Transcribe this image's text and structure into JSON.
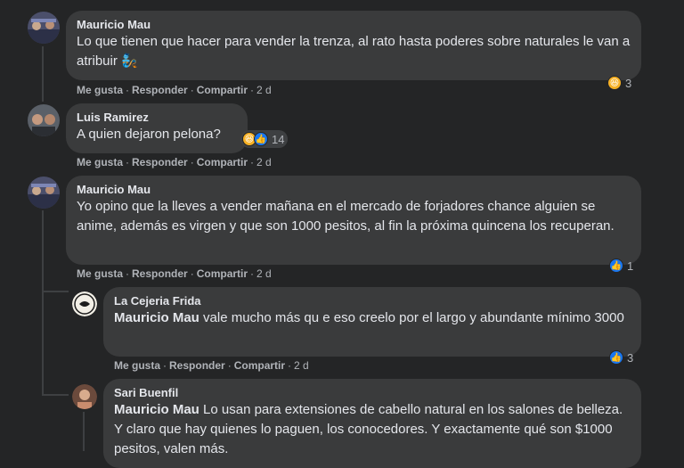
{
  "actions": {
    "like": "Me gusta",
    "reply": "Responder",
    "share": "Compartir",
    "sep": "·"
  },
  "comments": [
    {
      "author": "Mauricio Mau",
      "text": "Lo que tienen que hacer para vender la trenza, al rato hasta poderes sobre naturales le van a atribuir 🧞",
      "time": "2 d",
      "reactions": {
        "icons": [
          "haha"
        ],
        "count": "3"
      }
    },
    {
      "author": "Luis Ramirez",
      "text": "A quien dejaron pelona?",
      "time": "2 d",
      "reactions": {
        "icons": [
          "haha",
          "like"
        ],
        "count": "14"
      }
    },
    {
      "author": "Mauricio Mau",
      "text": "Yo opino que la lleves a vender mañana en el mercado de forjadores chance alguien se anime, además es virgen y que son 1000 pesitos, al fin la próxima quincena los recuperan.",
      "time": "2 d",
      "reactions": {
        "icons": [
          "like"
        ],
        "count": "1"
      }
    }
  ],
  "replies": [
    {
      "author": "La Cejeria Frida",
      "mention": "Mauricio Mau",
      "text": " vale mucho más qu e eso creelo por el largo y abundante mínimo 3000",
      "time": "2 d",
      "reactions": {
        "icons": [
          "like"
        ],
        "count": "3"
      }
    },
    {
      "author": "Sari Buenfil",
      "mention": "Mauricio Mau",
      "text": " Lo usan para extensiones de cabello natural en los salones de belleza. Y claro que hay quienes lo paguen, los conocedores. Y exactamente qué son $1000 pesitos, valen más."
    }
  ],
  "colors": {
    "background": "#242526",
    "bubble": "#3a3b3c",
    "text": "#e4e6eb",
    "muted": "#b0b3b8",
    "like": "#1877f2",
    "haha": "#f7b125"
  }
}
